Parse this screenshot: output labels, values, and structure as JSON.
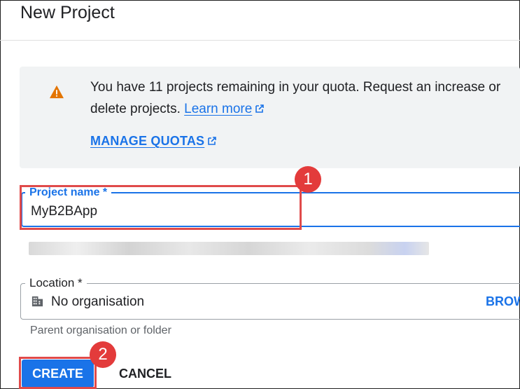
{
  "dialog": {
    "title": "New Project"
  },
  "notice": {
    "icon": "warning-icon",
    "message": "You have 11 projects remaining in your quota. Request an increase or delete projects.",
    "learn_more": "Learn more",
    "manage_quotas": "MANAGE QUOTAS"
  },
  "project_name": {
    "label": "Project name *",
    "value": "MyB2BApp"
  },
  "location": {
    "label": "Location *",
    "value": "No organisation",
    "browse": "BROW",
    "hint": "Parent organisation or folder",
    "icon": "organization-icon"
  },
  "buttons": {
    "create": "CREATE",
    "cancel": "CANCEL"
  },
  "annotations": {
    "step1": "1",
    "step2": "2"
  },
  "colors": {
    "accent": "#1a73e8",
    "highlight": "#e04a4a",
    "warning": "#e37400"
  }
}
